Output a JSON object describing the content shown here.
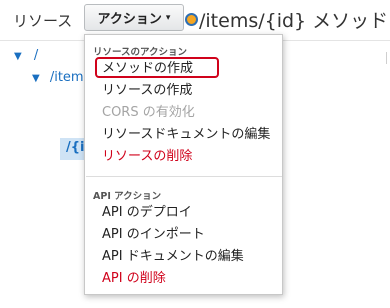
{
  "header": {
    "resources_label": "リソース",
    "actions_button": "アクション",
    "page_title": "/items/{id} メソッド"
  },
  "tree": {
    "root": "/",
    "items": "/items",
    "id": "/{id}"
  },
  "menu": {
    "resource_section": "リソースのアクション",
    "resource_actions": [
      {
        "label": "メソッドの作成",
        "state": "highlighted"
      },
      {
        "label": "リソースの作成",
        "state": "normal"
      },
      {
        "label": "CORS の有効化",
        "state": "disabled"
      },
      {
        "label": "リソースドキュメントの編集",
        "state": "normal"
      },
      {
        "label": "リソースの削除",
        "state": "danger"
      }
    ],
    "api_section": "API アクション",
    "api_actions": [
      {
        "label": "API のデプロイ",
        "state": "normal"
      },
      {
        "label": "API のインポート",
        "state": "normal"
      },
      {
        "label": "API ドキュメントの編集",
        "state": "normal"
      },
      {
        "label": "API の削除",
        "state": "danger"
      }
    ]
  },
  "colors": {
    "link": "#1a6fc0",
    "danger": "#d0021b",
    "disabled": "#a4a4a4",
    "status_dot": "#f5a623",
    "selected_bg": "#cfe3f5"
  }
}
